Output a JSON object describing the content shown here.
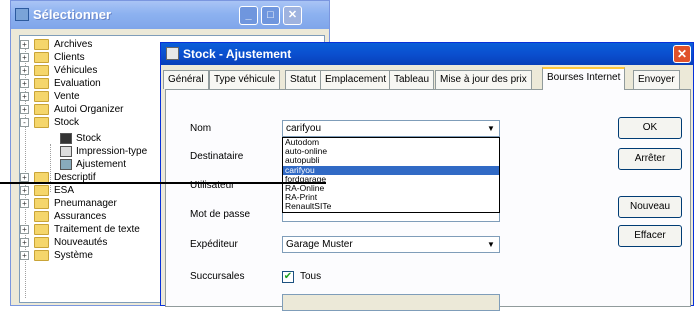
{
  "selector_window": {
    "title": "Sélectionner",
    "tree": {
      "items": [
        {
          "label": "Archives",
          "expander": "+"
        },
        {
          "label": "Clients",
          "expander": "+"
        },
        {
          "label": "Véhicules",
          "expander": "+"
        },
        {
          "label": "Evaluation",
          "expander": "+"
        },
        {
          "label": "Vente",
          "expander": "+"
        },
        {
          "label": "Autoi Organizer",
          "expander": "+"
        },
        {
          "label": "Stock",
          "expander": "-"
        },
        {
          "label": "Stock",
          "child": true
        },
        {
          "label": "Impression-type",
          "child": true
        },
        {
          "label": "Ajustement",
          "child": true
        },
        {
          "label": "Descriptif",
          "expander": "+"
        },
        {
          "label": "ESA",
          "expander": "+"
        },
        {
          "label": "Pneumanager",
          "expander": "+"
        },
        {
          "label": "Assurances",
          "expander": ""
        },
        {
          "label": "Traitement de texte",
          "expander": "+"
        },
        {
          "label": "Nouveautés",
          "expander": "+"
        },
        {
          "label": "Système",
          "expander": "+"
        }
      ]
    }
  },
  "stock_window": {
    "title": "Stock - Ajustement",
    "tabs": [
      {
        "label": "Général"
      },
      {
        "label": "Type véhicule"
      },
      {
        "label": "Statut"
      },
      {
        "label": "Emplacement"
      },
      {
        "label": "Tableau"
      },
      {
        "label": "Mise à jour des prix"
      },
      {
        "label": "Bourses Internet",
        "active": true
      },
      {
        "label": "Envoyer"
      }
    ],
    "form": {
      "nom_label": "Nom",
      "nom_value": "carifyou",
      "destinataire_label": "Destinataire",
      "utilisateur_label": "Utilisateur",
      "mot_de_passe_label": "Mot de passe",
      "expediteur_label": "Expéditeur",
      "expediteur_value": "Garage Muster",
      "succursales_label": "Succursales",
      "succursales_check_label": "Tous",
      "succursales_checked": true,
      "dropdown_options": [
        "Autodom",
        "auto-online",
        "autopubli",
        "carifyou",
        "fordgarage",
        "RA-Online",
        "RA-Print",
        "RenaultSITe"
      ],
      "dropdown_selected": "carifyou"
    },
    "buttons": {
      "ok": "OK",
      "arreter": "Arrêter",
      "nouveau": "Nouveau",
      "effacer": "Effacer"
    }
  }
}
